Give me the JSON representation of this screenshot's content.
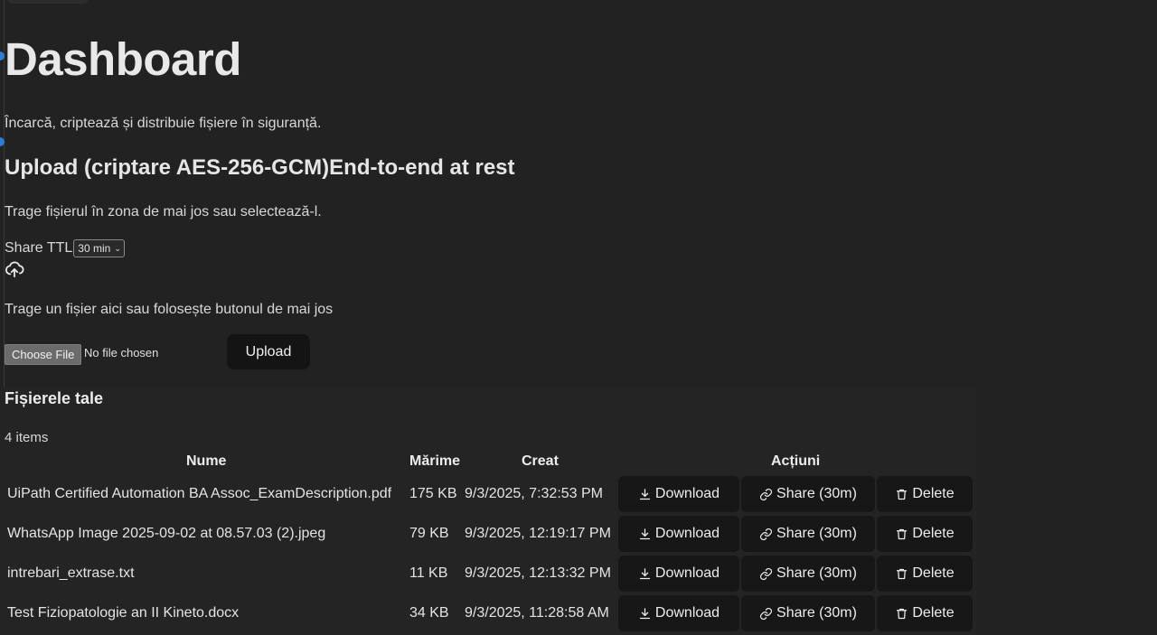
{
  "header": {
    "title": "Dashboard",
    "subtitle": "Încarcă, criptează și distribuie fișiere în siguranță."
  },
  "upload": {
    "heading": "Upload (criptare AES-256-GCM)End-to-end at rest",
    "hint": "Trage fișierul în zona de mai jos sau selectează-l.",
    "ttl_label": "Share TTL",
    "ttl_value": "30 min",
    "upload_icon": "cloud-upload-icon",
    "drop_text": "Trage un fișier aici sau folosește butonul de mai jos",
    "choose_label": "Choose File",
    "no_file_text": "No file chosen",
    "upload_button": "Upload"
  },
  "files": {
    "heading": "Fișierele tale",
    "count_text": "4 items",
    "columns": {
      "name": "Nume",
      "size": "Mărime",
      "created": "Creat",
      "actions": "Acțiuni"
    },
    "rows": [
      {
        "name": "UiPath Certified Automation BA Assoc_ExamDescription.pdf",
        "size": "175 KB",
        "created": "9/3/2025, 7:32:53 PM"
      },
      {
        "name": "WhatsApp Image 2025-09-02 at 08.57.03 (2).jpeg",
        "size": "79 KB",
        "created": "9/3/2025, 12:19:17 PM"
      },
      {
        "name": "intrebari_extrase.txt",
        "size": "11 KB",
        "created": "9/3/2025, 12:13:32 PM"
      },
      {
        "name": "Test Fiziopatologie an II Kineto.docx",
        "size": "34 KB",
        "created": "9/3/2025, 11:28:58 AM"
      }
    ],
    "actions": {
      "download": "Download",
      "share": "Share (30m)",
      "delete": "Delete",
      "download_icon": "download-icon",
      "share_icon": "link-icon",
      "delete_icon": "trash-icon"
    }
  },
  "colors": {
    "background": "#222222",
    "button_dark": "#171717",
    "text": "#e6e6e6"
  }
}
